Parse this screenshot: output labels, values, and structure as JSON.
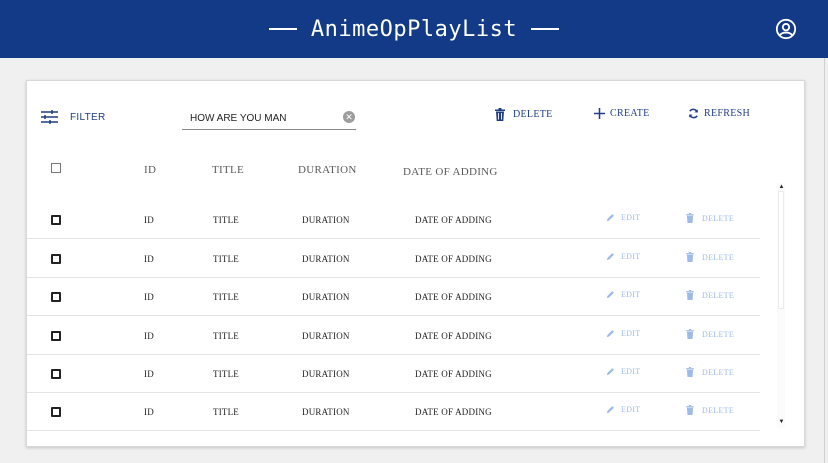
{
  "app": {
    "title": "AnimeOpPlayList"
  },
  "icons": {
    "account": "account-circle-icon",
    "filter": "tune-icon",
    "clear": "clear-icon",
    "delete": "trash-icon",
    "create": "plus-icon",
    "refresh": "refresh-icon",
    "edit": "pencil-icon"
  },
  "colors": {
    "appbar": "#123a86",
    "action": "#1f3d86",
    "row_action_disabled": "#9dbbe8"
  },
  "toolbar": {
    "filter_label": "FILTER",
    "search_value": "HOW ARE YOU MAN",
    "delete_label": "DELETE",
    "create_label": "CREATE",
    "refresh_label": "REFRESH"
  },
  "table": {
    "headers": {
      "id": "ID",
      "title": "TITLE",
      "duration": "DURATION",
      "date": "DATE OF ADDING"
    },
    "rows": [
      {
        "id": "ID",
        "title": "TITLE",
        "duration": "DURATION",
        "date": "DATE OF ADDING",
        "edit": "EDIT",
        "delete": "DELETE"
      },
      {
        "id": "ID",
        "title": "TITLE",
        "duration": "DURATION",
        "date": "DATE OF ADDING",
        "edit": "EDIT",
        "delete": "DELETE"
      },
      {
        "id": "ID",
        "title": "TITLE",
        "duration": "DURATION",
        "date": "DATE OF ADDING",
        "edit": "EDIT",
        "delete": "DELETE"
      },
      {
        "id": "ID",
        "title": "TITLE",
        "duration": "DURATION",
        "date": "DATE OF ADDING",
        "edit": "EDIT",
        "delete": "DELETE"
      },
      {
        "id": "ID",
        "title": "TITLE",
        "duration": "DURATION",
        "date": "DATE OF ADDING",
        "edit": "EDIT",
        "delete": "DELETE"
      },
      {
        "id": "ID",
        "title": "TITLE",
        "duration": "DURATION",
        "date": "DATE OF ADDING",
        "edit": "EDIT",
        "delete": "DELETE"
      }
    ]
  }
}
